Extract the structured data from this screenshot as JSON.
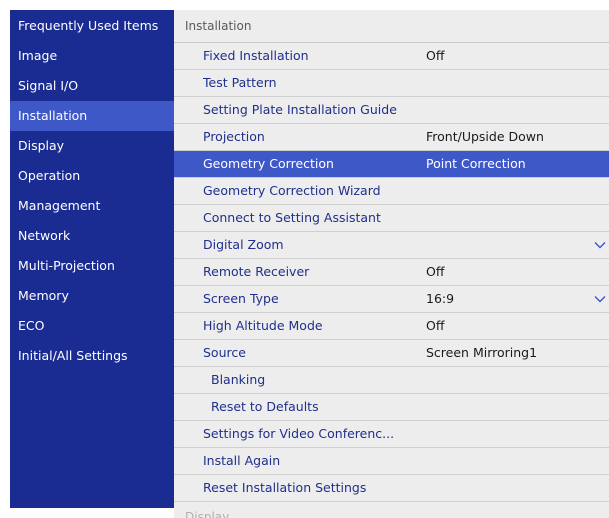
{
  "sidebar": {
    "items": [
      {
        "label": "Frequently Used Items"
      },
      {
        "label": "Image"
      },
      {
        "label": "Signal I/O"
      },
      {
        "label": "Installation"
      },
      {
        "label": "Display"
      },
      {
        "label": "Operation"
      },
      {
        "label": "Management"
      },
      {
        "label": "Network"
      },
      {
        "label": "Multi-Projection"
      },
      {
        "label": "Memory"
      },
      {
        "label": "ECO"
      },
      {
        "label": "Initial/All Settings"
      }
    ],
    "active_index": 3
  },
  "panel": {
    "title": "Installation",
    "rows": [
      {
        "label": "Fixed Installation",
        "value": "Off"
      },
      {
        "label": "Test Pattern",
        "value": ""
      },
      {
        "label": "Setting Plate Installation Guide",
        "value": ""
      },
      {
        "label": "Projection",
        "value": "Front/Upside Down"
      },
      {
        "label": "Geometry Correction",
        "value": "Point Correction"
      },
      {
        "label": "Geometry Correction Wizard",
        "value": ""
      },
      {
        "label": "Connect to Setting Assistant",
        "value": ""
      },
      {
        "label": "Digital Zoom",
        "value": ""
      },
      {
        "label": "Remote Receiver",
        "value": "Off"
      },
      {
        "label": "Screen Type",
        "value": "16:9"
      },
      {
        "label": "High Altitude Mode",
        "value": "Off"
      },
      {
        "label": "Source",
        "value": "Screen Mirroring1"
      },
      {
        "label": "Blanking",
        "value": ""
      },
      {
        "label": "Reset to Defaults",
        "value": ""
      },
      {
        "label": "Settings for Video Conferenc...",
        "value": ""
      },
      {
        "label": "Install Again",
        "value": ""
      },
      {
        "label": "Reset Installation Settings",
        "value": ""
      }
    ],
    "selected_index": 4,
    "next_section_title": "Display"
  },
  "icons": {
    "expand": "chevron-down-icon"
  },
  "colors": {
    "sidebar_bg": "#1a2c92",
    "highlight": "#3f58c8",
    "panel_bg": "#ededed",
    "label_text": "#1f2f8c"
  }
}
